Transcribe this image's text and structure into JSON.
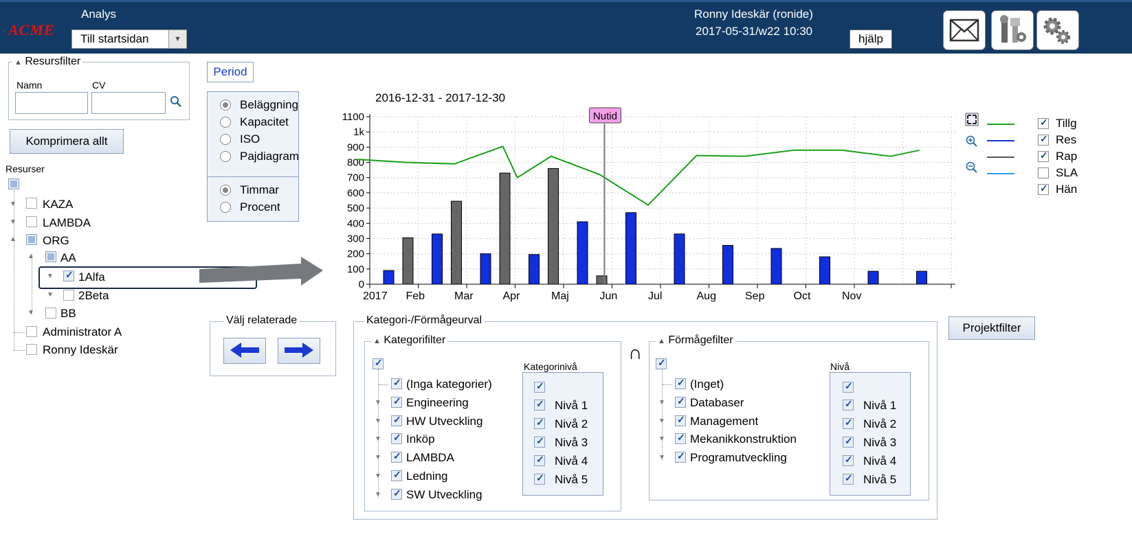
{
  "header": {
    "logo": "ACME",
    "app_title": "Analys",
    "start_select": "Till startsidan",
    "user_name": "Ronny Ideskär (ronide)",
    "user_date": "2017-05-31/w22 10:30",
    "help": "hjälp",
    "icons": [
      "mail-icon",
      "tools-icon",
      "settings-gears-icon"
    ]
  },
  "resource_filter": {
    "legend": "Resursfilter",
    "name_label": "Namn",
    "cv_label": "CV",
    "name_value": "",
    "cv_value": ""
  },
  "compress_button": "Komprimera allt",
  "resources": {
    "title": "Resurser",
    "items": [
      {
        "label": "KAZA",
        "checked": false
      },
      {
        "label": "LAMBDA",
        "checked": false
      },
      {
        "label": "ORG",
        "checked": "partial"
      },
      {
        "label": "AA",
        "checked": "partial"
      },
      {
        "label": "1Alfa",
        "checked": true
      },
      {
        "label": "2Beta",
        "checked": false
      },
      {
        "label": "BB",
        "checked": false
      },
      {
        "label": "Administrator A",
        "checked": false
      },
      {
        "label": "Ronny Ideskär",
        "checked": false
      }
    ]
  },
  "period_button": "Period",
  "view_options": {
    "modes": [
      {
        "label": "Beläggning",
        "selected": true
      },
      {
        "label": "Kapacitet",
        "selected": false
      },
      {
        "label": "ISO",
        "selected": false
      },
      {
        "label": "Pajdiagram",
        "selected": false
      }
    ],
    "units": [
      {
        "label": "Timmar",
        "selected": true
      },
      {
        "label": "Procent",
        "selected": false
      }
    ]
  },
  "related": {
    "legend": "Välj relaterade"
  },
  "chart_data": {
    "type": "bar",
    "title": "2016-12-31 - 2017-12-30",
    "now_label": "Nutid",
    "x_tick_labels": [
      "2017",
      "Feb",
      "Mar",
      "Apr",
      "Maj",
      "Jun",
      "Jul",
      "Aug",
      "Sep",
      "Oct",
      "Nov"
    ],
    "y_tick_labels": [
      "0",
      "100",
      "200",
      "300",
      "400",
      "500",
      "600",
      "700",
      "800",
      "900",
      "1k",
      "1100"
    ],
    "ylim": [
      0,
      1100
    ],
    "grid": true,
    "bar_series": [
      {
        "color": "#1030e0",
        "months": [
          0,
          1,
          2,
          3,
          4,
          5,
          6,
          7,
          8,
          9,
          10,
          11
        ],
        "values": [
          90,
          330,
          200,
          195,
          410,
          470,
          330,
          255,
          235,
          180,
          85,
          85
        ]
      },
      {
        "color": "#666666",
        "months": [
          0,
          1,
          2,
          3,
          4
        ],
        "values": [
          305,
          545,
          730,
          760,
          55
        ]
      }
    ],
    "line_series": {
      "color": "#1aa01a",
      "x": [
        0,
        1,
        2,
        3,
        3.3,
        4,
        5,
        6,
        7,
        8,
        9,
        10,
        11,
        11.6
      ],
      "values": [
        820,
        800,
        790,
        905,
        700,
        840,
        720,
        520,
        845,
        840,
        880,
        880,
        840,
        880
      ]
    },
    "now_month": 4.9,
    "legend": [
      {
        "label": "Tillg",
        "color": "#1aa01a",
        "checked": true
      },
      {
        "label": "Res",
        "color": "#1030e0",
        "checked": true
      },
      {
        "label": "Rap",
        "color": "#555555",
        "checked": true
      },
      {
        "label": "SLA",
        "color": "#2aa0ee",
        "checked": false
      },
      {
        "label": "Hän",
        "color": "",
        "checked": true
      }
    ]
  },
  "chart_tools": [
    "fullscreen-icon",
    "zoom-in-icon",
    "zoom-out-icon"
  ],
  "project_filter_button": "Projektfilter",
  "category_selection": {
    "legend": "Kategori-/Förmågeurval",
    "intersection": "∩",
    "category_filter": {
      "legend": "Kategorifilter",
      "items": [
        "(Inga kategorier)",
        "Engineering",
        "HW Utveckling",
        "Inköp",
        "LAMBDA",
        "Ledning",
        "SW Utveckling"
      ],
      "level_title": "Kategorinivå",
      "levels": [
        "Nivå 1",
        "Nivå 2",
        "Nivå 3",
        "Nivå 4",
        "Nivå 5"
      ]
    },
    "ability_filter": {
      "legend": "Förmågefilter",
      "items": [
        "(Inget)",
        "Databaser",
        "Management",
        "Mekanikkonstruktion",
        "Programutveckling"
      ],
      "level_title": "Nivå",
      "levels": [
        "Nivå 1",
        "Nivå 2",
        "Nivå 3",
        "Nivå 4",
        "Nivå 5"
      ]
    }
  }
}
